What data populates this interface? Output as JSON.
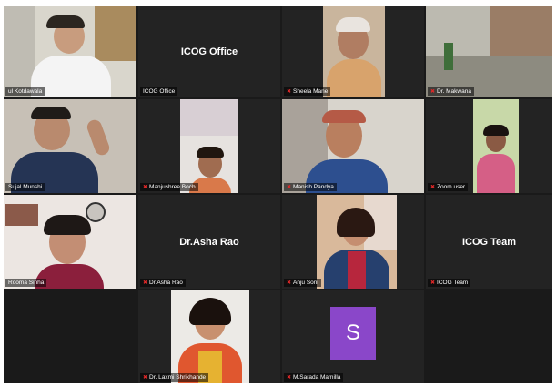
{
  "meeting": {
    "participants": [
      {
        "name": "ul Kotdawala",
        "muted": false,
        "has_video": true
      },
      {
        "name": "ICOG Office",
        "label": "ICOG Office",
        "muted": false,
        "has_video": false
      },
      {
        "name": "Sheela Mane",
        "muted": true,
        "has_video": true
      },
      {
        "name": "Dr. Makwana",
        "muted": true,
        "has_video": true
      },
      {
        "name": "Sujal Munshi",
        "muted": false,
        "has_video": true
      },
      {
        "name": "Manjushree Bocb",
        "muted": true,
        "has_video": true
      },
      {
        "name": "Manish Pandya",
        "muted": true,
        "has_video": true
      },
      {
        "name": "Zoom user",
        "muted": true,
        "has_video": true
      },
      {
        "name": "Rooma Sinha",
        "muted": false,
        "has_video": true
      },
      {
        "name": "Dr.Asha Rao",
        "label": "Dr.Asha Rao",
        "muted": true,
        "has_video": false
      },
      {
        "name": "Anju Soni",
        "muted": true,
        "has_video": true
      },
      {
        "name": "ICOG Team",
        "label": "ICOG Team",
        "muted": true,
        "has_video": false
      },
      {
        "name": "Dr. Laxmi Shrikhande",
        "muted": true,
        "has_video": true
      },
      {
        "name": "M.Sarada Mamilla",
        "muted": true,
        "has_video": false,
        "avatar_letter": "S"
      }
    ]
  },
  "colors": {
    "tile_bg": "#232323",
    "grid_bg": "#1a1a1a",
    "active_speaker": "#e8e14a",
    "mic_muted": "#e02828",
    "avatar_bg": "#8a47c9"
  }
}
